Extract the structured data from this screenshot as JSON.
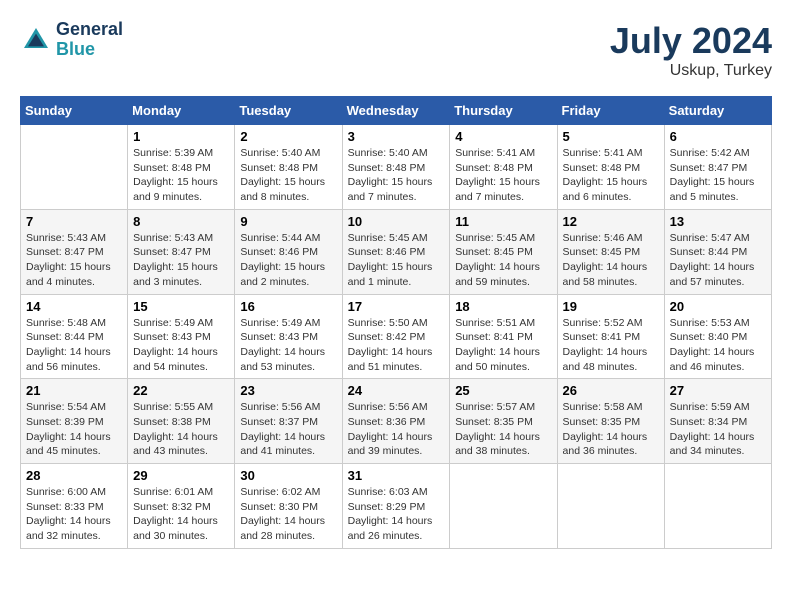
{
  "header": {
    "logo_line1": "General",
    "logo_line2": "Blue",
    "month_year": "July 2024",
    "location": "Uskup, Turkey"
  },
  "weekdays": [
    "Sunday",
    "Monday",
    "Tuesday",
    "Wednesday",
    "Thursday",
    "Friday",
    "Saturday"
  ],
  "weeks": [
    [
      {
        "day": "",
        "info": ""
      },
      {
        "day": "1",
        "info": "Sunrise: 5:39 AM\nSunset: 8:48 PM\nDaylight: 15 hours\nand 9 minutes."
      },
      {
        "day": "2",
        "info": "Sunrise: 5:40 AM\nSunset: 8:48 PM\nDaylight: 15 hours\nand 8 minutes."
      },
      {
        "day": "3",
        "info": "Sunrise: 5:40 AM\nSunset: 8:48 PM\nDaylight: 15 hours\nand 7 minutes."
      },
      {
        "day": "4",
        "info": "Sunrise: 5:41 AM\nSunset: 8:48 PM\nDaylight: 15 hours\nand 7 minutes."
      },
      {
        "day": "5",
        "info": "Sunrise: 5:41 AM\nSunset: 8:48 PM\nDaylight: 15 hours\nand 6 minutes."
      },
      {
        "day": "6",
        "info": "Sunrise: 5:42 AM\nSunset: 8:47 PM\nDaylight: 15 hours\nand 5 minutes."
      }
    ],
    [
      {
        "day": "7",
        "info": "Sunrise: 5:43 AM\nSunset: 8:47 PM\nDaylight: 15 hours\nand 4 minutes."
      },
      {
        "day": "8",
        "info": "Sunrise: 5:43 AM\nSunset: 8:47 PM\nDaylight: 15 hours\nand 3 minutes."
      },
      {
        "day": "9",
        "info": "Sunrise: 5:44 AM\nSunset: 8:46 PM\nDaylight: 15 hours\nand 2 minutes."
      },
      {
        "day": "10",
        "info": "Sunrise: 5:45 AM\nSunset: 8:46 PM\nDaylight: 15 hours\nand 1 minute."
      },
      {
        "day": "11",
        "info": "Sunrise: 5:45 AM\nSunset: 8:45 PM\nDaylight: 14 hours\nand 59 minutes."
      },
      {
        "day": "12",
        "info": "Sunrise: 5:46 AM\nSunset: 8:45 PM\nDaylight: 14 hours\nand 58 minutes."
      },
      {
        "day": "13",
        "info": "Sunrise: 5:47 AM\nSunset: 8:44 PM\nDaylight: 14 hours\nand 57 minutes."
      }
    ],
    [
      {
        "day": "14",
        "info": "Sunrise: 5:48 AM\nSunset: 8:44 PM\nDaylight: 14 hours\nand 56 minutes."
      },
      {
        "day": "15",
        "info": "Sunrise: 5:49 AM\nSunset: 8:43 PM\nDaylight: 14 hours\nand 54 minutes."
      },
      {
        "day": "16",
        "info": "Sunrise: 5:49 AM\nSunset: 8:43 PM\nDaylight: 14 hours\nand 53 minutes."
      },
      {
        "day": "17",
        "info": "Sunrise: 5:50 AM\nSunset: 8:42 PM\nDaylight: 14 hours\nand 51 minutes."
      },
      {
        "day": "18",
        "info": "Sunrise: 5:51 AM\nSunset: 8:41 PM\nDaylight: 14 hours\nand 50 minutes."
      },
      {
        "day": "19",
        "info": "Sunrise: 5:52 AM\nSunset: 8:41 PM\nDaylight: 14 hours\nand 48 minutes."
      },
      {
        "day": "20",
        "info": "Sunrise: 5:53 AM\nSunset: 8:40 PM\nDaylight: 14 hours\nand 46 minutes."
      }
    ],
    [
      {
        "day": "21",
        "info": "Sunrise: 5:54 AM\nSunset: 8:39 PM\nDaylight: 14 hours\nand 45 minutes."
      },
      {
        "day": "22",
        "info": "Sunrise: 5:55 AM\nSunset: 8:38 PM\nDaylight: 14 hours\nand 43 minutes."
      },
      {
        "day": "23",
        "info": "Sunrise: 5:56 AM\nSunset: 8:37 PM\nDaylight: 14 hours\nand 41 minutes."
      },
      {
        "day": "24",
        "info": "Sunrise: 5:56 AM\nSunset: 8:36 PM\nDaylight: 14 hours\nand 39 minutes."
      },
      {
        "day": "25",
        "info": "Sunrise: 5:57 AM\nSunset: 8:35 PM\nDaylight: 14 hours\nand 38 minutes."
      },
      {
        "day": "26",
        "info": "Sunrise: 5:58 AM\nSunset: 8:35 PM\nDaylight: 14 hours\nand 36 minutes."
      },
      {
        "day": "27",
        "info": "Sunrise: 5:59 AM\nSunset: 8:34 PM\nDaylight: 14 hours\nand 34 minutes."
      }
    ],
    [
      {
        "day": "28",
        "info": "Sunrise: 6:00 AM\nSunset: 8:33 PM\nDaylight: 14 hours\nand 32 minutes."
      },
      {
        "day": "29",
        "info": "Sunrise: 6:01 AM\nSunset: 8:32 PM\nDaylight: 14 hours\nand 30 minutes."
      },
      {
        "day": "30",
        "info": "Sunrise: 6:02 AM\nSunset: 8:30 PM\nDaylight: 14 hours\nand 28 minutes."
      },
      {
        "day": "31",
        "info": "Sunrise: 6:03 AM\nSunset: 8:29 PM\nDaylight: 14 hours\nand 26 minutes."
      },
      {
        "day": "",
        "info": ""
      },
      {
        "day": "",
        "info": ""
      },
      {
        "day": "",
        "info": ""
      }
    ]
  ]
}
